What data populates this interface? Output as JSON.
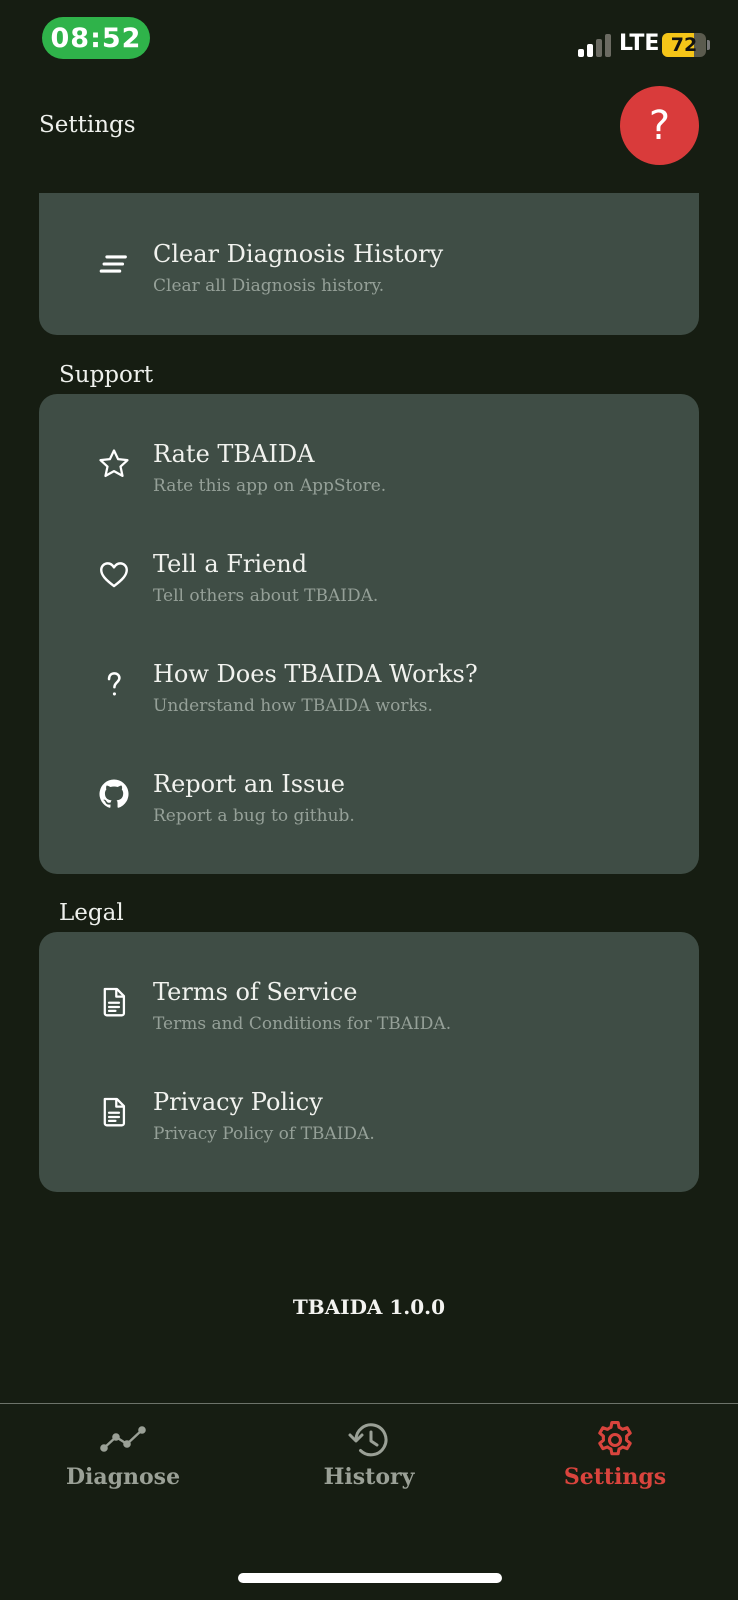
{
  "status_bar": {
    "time": "08:52",
    "network": "LTE",
    "battery": "72",
    "battery_level": 0.72,
    "signal_bars": 2,
    "colors": {
      "time_pill": "#2fb34a",
      "battery": "#f5c518"
    }
  },
  "header": {
    "title": "Settings",
    "help_icon": "question-mark-icon",
    "help_label": "?",
    "help_color": "#d93b3b"
  },
  "sections": {
    "data_items": [
      {
        "title": "Clear Diagnosis History",
        "subtitle": "Clear all Diagnosis history.",
        "icon": "clear-all-icon"
      }
    ],
    "support": {
      "label": "Support",
      "items": [
        {
          "title": "Rate TBAIDA",
          "subtitle": "Rate this app on AppStore.",
          "icon": "star-icon"
        },
        {
          "title": "Tell a Friend",
          "subtitle": "Tell others about TBAIDA.",
          "icon": "heart-icon"
        },
        {
          "title": "How Does TBAIDA Works?",
          "subtitle": "Understand how TBAIDA works.",
          "icon": "question-icon"
        },
        {
          "title": "Report an Issue",
          "subtitle": "Report a bug to github.",
          "icon": "github-icon"
        }
      ]
    },
    "legal": {
      "label": "Legal",
      "items": [
        {
          "title": "Terms of Service",
          "subtitle": "Terms and Conditions for TBAIDA.",
          "icon": "document-icon"
        },
        {
          "title": "Privacy Policy",
          "subtitle": "Privacy Policy of TBAIDA.",
          "icon": "document-icon"
        }
      ]
    }
  },
  "footer": {
    "version": "TBAIDA 1.0.0"
  },
  "bottom_nav": {
    "tabs": [
      {
        "label": "Diagnose",
        "icon": "trend-line-icon",
        "active": false
      },
      {
        "label": "History",
        "icon": "history-icon",
        "active": false
      },
      {
        "label": "Settings",
        "icon": "gear-icon",
        "active": true
      }
    ],
    "active_color": "#d9443d",
    "inactive_color": "#9aa096"
  }
}
